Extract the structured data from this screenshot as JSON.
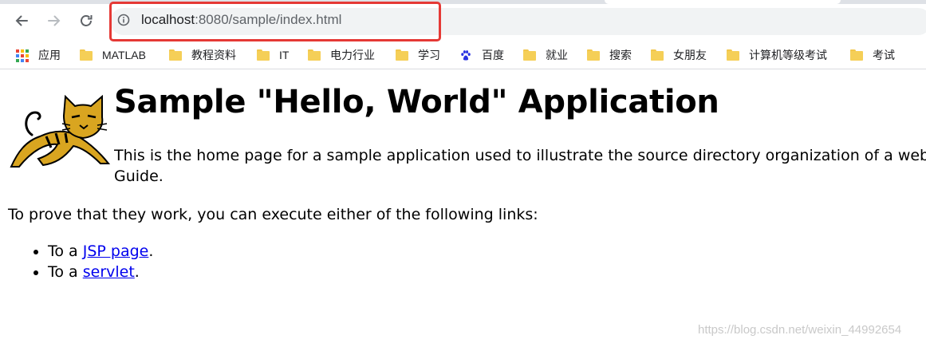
{
  "browser": {
    "url_host": "localhost",
    "url_path": ":8080/sample/index.html",
    "nav_icons": [
      "back-arrow-icon",
      "forward-arrow-icon",
      "reload-icon",
      "info-icon"
    ],
    "bookmarks": [
      {
        "label": "应用",
        "icon": "apps-grid-icon"
      },
      {
        "label": "MATLAB",
        "icon": "folder-icon"
      },
      {
        "label": "教程资料",
        "icon": "folder-icon"
      },
      {
        "label": "IT",
        "icon": "folder-icon"
      },
      {
        "label": "电力行业",
        "icon": "folder-icon"
      },
      {
        "label": "学习",
        "icon": "folder-icon"
      },
      {
        "label": "百度",
        "icon": "baidu-paw-icon"
      },
      {
        "label": "就业",
        "icon": "folder-icon"
      },
      {
        "label": "搜索",
        "icon": "folder-icon"
      },
      {
        "label": "女朋友",
        "icon": "folder-icon"
      },
      {
        "label": "计算机等级考试",
        "icon": "folder-icon"
      },
      {
        "label": "考试",
        "icon": "folder-icon"
      }
    ]
  },
  "page": {
    "title": "Sample \"Hello, World\" Application",
    "intro_line1": "This is the home page for a sample application used to illustrate the source directory organization of a web",
    "intro_line2": "Guide.",
    "prove_text": "To prove that they work, you can execute either of the following links:",
    "links": [
      {
        "prefix": "To a ",
        "link_text": "JSP page",
        "suffix": "."
      },
      {
        "prefix": "To a ",
        "link_text": "servlet",
        "suffix": "."
      }
    ]
  },
  "watermark": "https://blog.csdn.net/weixin_44992654",
  "colors": {
    "highlight": "#e53935",
    "link": "#0000ee",
    "folder": "#f5cf57"
  }
}
